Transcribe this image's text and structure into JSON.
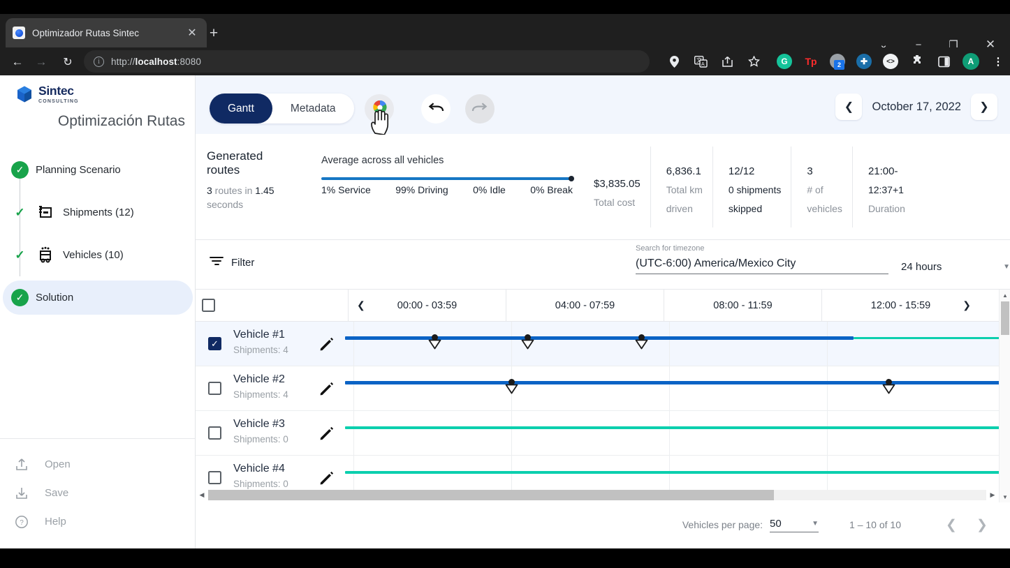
{
  "browser": {
    "tab_title": "Optimizador Rutas Sintec",
    "tab_close_icon": "close-icon",
    "new_tab_icon": "plus-icon",
    "url_prefix": "http://",
    "url_host": "localhost",
    "url_suffix": ":8080",
    "back_icon": "arrow-left-icon",
    "forward_icon": "arrow-right-icon",
    "reload_icon": "reload-icon",
    "window_controls": [
      "chevron-down-icon",
      "minimize-icon",
      "restore-icon",
      "close-icon"
    ],
    "omnibox_icons": [
      "location-pin-icon",
      "translate-icon",
      "share-icon",
      "bookmark-star-icon"
    ],
    "extension_icons": [
      "grammarly-icon",
      "teachers-pay-teachers-icon",
      "notification-icon",
      "colorzilla-icon",
      "code-icon",
      "puzzle-extension-icon",
      "side-panel-icon",
      "profile-avatar-icon",
      "kebab-menu-icon"
    ],
    "profile_initial": "A",
    "badge_count": "2"
  },
  "sidebar": {
    "brand": {
      "name": "Sintec",
      "sub": "CONSULTING"
    },
    "app_title": "Optimización Rutas",
    "steps": [
      {
        "label": "Planning Scenario",
        "level": 0,
        "state": "done",
        "icon": "check-circle-icon",
        "active": false
      },
      {
        "label": "Shipments (12)",
        "level": 1,
        "state": "check",
        "icon": "shipments-icon",
        "active": false
      },
      {
        "label": "Vehicles (10)",
        "level": 1,
        "state": "check",
        "icon": "vehicle-icon",
        "active": false
      },
      {
        "label": "Solution",
        "level": 0,
        "state": "done",
        "icon": "check-circle-icon",
        "active": true
      }
    ],
    "bottom_links": [
      {
        "label": "Open",
        "icon": "upload-icon"
      },
      {
        "label": "Save",
        "icon": "download-icon"
      },
      {
        "label": "Help",
        "icon": "help-circle-icon"
      }
    ]
  },
  "toolbar": {
    "tabs": [
      {
        "label": "Gantt",
        "selected": true
      },
      {
        "label": "Metadata",
        "selected": false
      }
    ],
    "maps_button_icon": "google-maps-pin-icon",
    "undo_icon": "undo-icon",
    "redo_icon": "redo-icon",
    "date": "October 17, 2022",
    "prev_date_icon": "chevron-left-icon",
    "next_date_icon": "chevron-right-icon"
  },
  "stats": {
    "generated_title_line1": "Generated",
    "generated_title_line2": "routes",
    "generated_sub_pre": "3",
    "generated_sub_mid": " routes in ",
    "generated_sub_val": "1.45",
    "generated_sub_post": " seconds",
    "avg_title": "Average across all vehicles",
    "avg_legend": [
      "1% Service",
      "99% Driving",
      "0% Idle",
      "0% Break"
    ],
    "kpis": [
      {
        "value": "$3,835.05",
        "label_lines": [
          "Total cost"
        ],
        "value_first": false
      },
      {
        "value": "6,836.1",
        "label_lines": [
          "Total km",
          "driven"
        ],
        "value_first": true
      },
      {
        "value": "12/12",
        "label_lines": [
          "0 shipments",
          "skipped"
        ],
        "value_first": true,
        "label_dark": true
      },
      {
        "value": "3",
        "label_lines": [
          "# of",
          "vehicles"
        ],
        "value_first": true
      },
      {
        "value": "21:00-",
        "label_lines": [
          "12:37+1",
          "Duration"
        ],
        "value_first": true,
        "label_first_dark": true
      }
    ]
  },
  "filter_row": {
    "filter_label": "Filter",
    "filter_icon": "filter-icon",
    "timezone_label": "Search for timezone",
    "timezone_value": "(UTC-6:00) America/Mexico City",
    "hours_value": "24 hours",
    "hours_caret_icon": "chevron-down-icon"
  },
  "gantt": {
    "header_checkbox_icon": "checkbox-icon",
    "prev_icon": "chevron-left-icon",
    "next_icon": "chevron-right-icon",
    "time_columns": [
      "00:00 - 03:59",
      "04:00 - 07:59",
      "08:00 - 11:59",
      "12:00 - 15:59"
    ],
    "rows": [
      {
        "name": "Vehicle #1",
        "shipments": "Shipments: 4",
        "checked": true,
        "edit_icon": "pencil-icon",
        "bars": [
          {
            "color": "blue",
            "start_pct": 0,
            "end_pct": 76.5
          },
          {
            "color": "teal",
            "start_pct": 76.5,
            "end_pct": 100
          }
        ],
        "stops_pct": [
          12.8,
          26.8,
          44.0
        ]
      },
      {
        "name": "Vehicle #2",
        "shipments": "Shipments: 4",
        "checked": false,
        "edit_icon": "pencil-icon",
        "bars": [
          {
            "color": "blue",
            "start_pct": 0,
            "end_pct": 100
          }
        ],
        "stops_pct": [
          24.2,
          81.1
        ]
      },
      {
        "name": "Vehicle #3",
        "shipments": "Shipments: 0",
        "checked": false,
        "edit_icon": "pencil-icon",
        "bars": [
          {
            "color": "teal",
            "start_pct": 0,
            "end_pct": 100
          }
        ],
        "stops_pct": []
      },
      {
        "name": "Vehicle #4",
        "shipments": "Shipments: 0",
        "checked": false,
        "edit_icon": "pencil-icon",
        "bars": [
          {
            "color": "teal",
            "start_pct": 0,
            "end_pct": 100
          }
        ],
        "stops_pct": []
      }
    ]
  },
  "paging": {
    "per_page_label": "Vehicles per page:",
    "per_page_value": "50",
    "caret_icon": "chevron-down-icon",
    "range": "1 – 10 of 10",
    "prev_icon": "chevron-left-icon",
    "next_icon": "chevron-right-icon"
  },
  "colors": {
    "brand_navy": "#102a63",
    "accent_blue": "#0b63c5",
    "accent_teal": "#0ccfae",
    "step_green": "#18a34a",
    "toolbar_bg": "#f2f6fd",
    "selected_row": "#f3f7fe"
  }
}
